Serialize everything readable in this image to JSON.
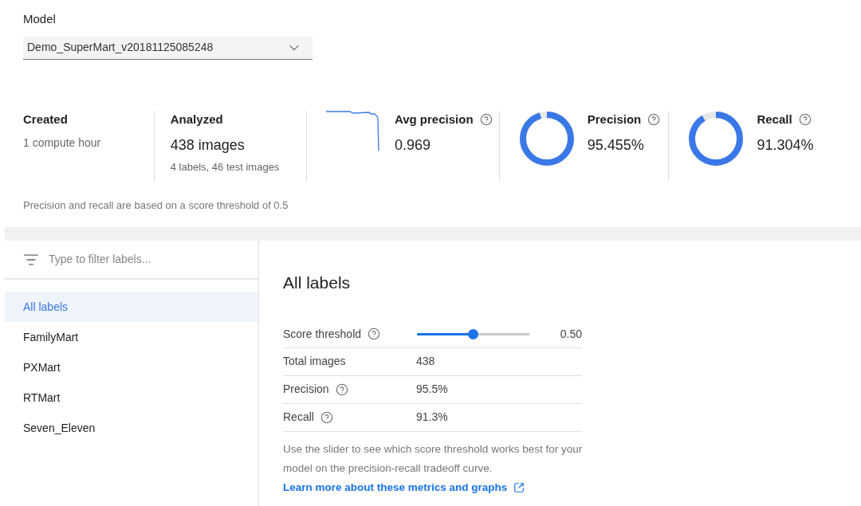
{
  "model": {
    "label": "Model",
    "value": "Demo_SuperMart_v20181125085248"
  },
  "stats": [
    {
      "kind": "text",
      "title": "Created",
      "value": "1 compute hour"
    },
    {
      "kind": "big",
      "title": "Analyzed",
      "value": "438 images",
      "sub": "4 labels, 46 test images"
    },
    {
      "kind": "curve",
      "title": "Avg precision",
      "value": "0.969"
    },
    {
      "kind": "donut",
      "title": "Precision",
      "value": "95.455%"
    },
    {
      "kind": "donut",
      "title": "Recall",
      "value": "91.304%"
    }
  ],
  "threshold_note": "Precision and recall are based on a score threshold of 0.5",
  "filter": {
    "placeholder": "Type to filter labels..."
  },
  "labels": [
    {
      "label": "All labels",
      "selected": true
    },
    {
      "label": "FamilyMart",
      "selected": false
    },
    {
      "label": "PXMart",
      "selected": false
    },
    {
      "label": "RTMart",
      "selected": false
    },
    {
      "label": "Seven_Eleven",
      "selected": false
    }
  ],
  "detail": {
    "title": "All labels",
    "slider": {
      "label": "Score threshold",
      "level": 0.5,
      "reading": "0.50"
    },
    "rows": [
      {
        "label": "Total images",
        "value": "438",
        "help": false
      },
      {
        "label": "Precision",
        "value": "95.5%",
        "help": true
      },
      {
        "label": "Recall",
        "value": "91.3%",
        "help": true
      }
    ],
    "note": "Use the slider to see which score threshold works best for your model on the precision-recall tradeoff curve.",
    "link": "Learn more about these metrics and graphs"
  }
}
